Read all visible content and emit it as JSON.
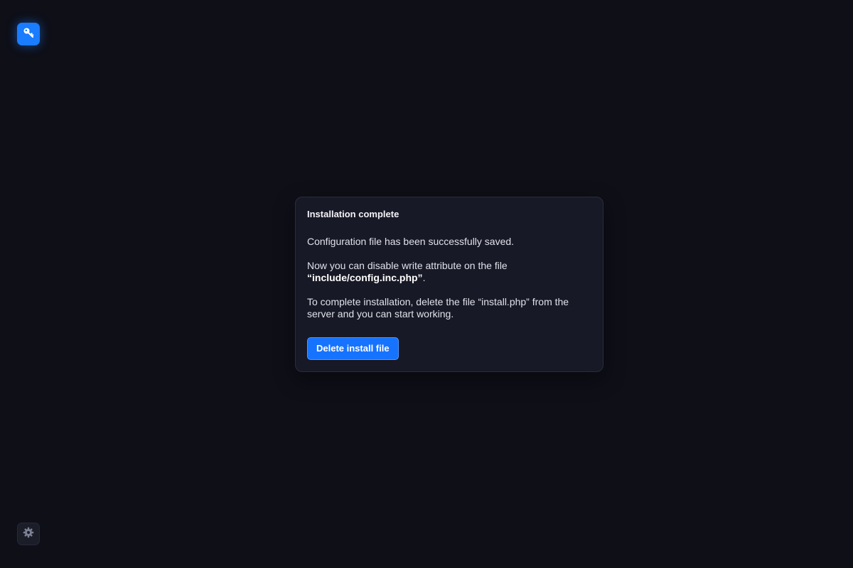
{
  "app": {
    "logo_icon": "key-icon",
    "accent_color": "#1a7cff"
  },
  "panel": {
    "title": "Installation complete",
    "saved_message": "Configuration file has been successfully saved.",
    "disable_write_text": "Now you can disable write attribute on the file",
    "config_file": "“include/config.inc.php”",
    "config_file_suffix": ".",
    "complete_text": "To complete installation, delete the file “install.php” from the server and you can start working.",
    "delete_button_label": "Delete install file"
  },
  "settings": {
    "icon": "gear-icon"
  }
}
